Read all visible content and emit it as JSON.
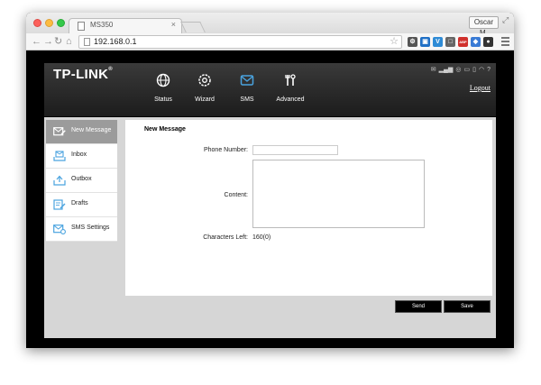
{
  "browser": {
    "tab_title": "MS350",
    "tab_close": "×",
    "user_button": "Oscar M.",
    "url": "192.168.0.1",
    "extensions": [
      {
        "name": "gear-extension-icon",
        "color": "#555555",
        "glyph": "⚙"
      },
      {
        "name": "cast-icon",
        "color": "#1f6fc5",
        "glyph": "▣"
      },
      {
        "name": "vpn-shield-icon",
        "color": "#2e8bd6",
        "glyph": "V"
      },
      {
        "name": "screen-icon",
        "color": "#666666",
        "glyph": "□"
      },
      {
        "name": "adblock-icon",
        "color": "#d0302c",
        "glyph": "ABP"
      },
      {
        "name": "puzzle-icon",
        "color": "#3a7bd5",
        "glyph": "◆"
      },
      {
        "name": "dark-circle-icon",
        "color": "#333333",
        "glyph": "●"
      }
    ]
  },
  "router": {
    "logo": "TP-LINK",
    "logo_mark": "®",
    "logout": "Logout",
    "status_icons": [
      "envelope-icon",
      "signal-icon",
      "globe-icon",
      "battery-icon",
      "sim-icon",
      "wifi-icon",
      "help-icon"
    ],
    "status_glyphs": [
      "✉",
      "▂▄▆",
      "◎",
      "▭",
      "▯",
      "◠",
      "?"
    ],
    "nav": [
      {
        "key": "status",
        "label": "Status",
        "active": false
      },
      {
        "key": "wizard",
        "label": "Wizard",
        "active": false
      },
      {
        "key": "sms",
        "label": "SMS",
        "active": true
      },
      {
        "key": "advanced",
        "label": "Advanced",
        "active": false
      }
    ],
    "sidebar": [
      {
        "key": "new-message",
        "label": "New Message",
        "active": true
      },
      {
        "key": "inbox",
        "label": "Inbox",
        "active": false
      },
      {
        "key": "outbox",
        "label": "Outbox",
        "active": false
      },
      {
        "key": "drafts",
        "label": "Drafts",
        "active": false
      },
      {
        "key": "sms-settings",
        "label": "SMS Settings",
        "active": false
      }
    ],
    "form": {
      "title": "New Message",
      "phone_label": "Phone Number:",
      "phone_value": "",
      "content_label": "Content:",
      "content_value": "",
      "chars_label": "Characters Left:",
      "chars_value": "160(0)"
    },
    "buttons": {
      "send": "Send",
      "save": "Save"
    },
    "colors": {
      "accent_blue": "#4aa3df",
      "header_dark": "#262626",
      "active_sidebar": "#9b9b9b"
    }
  }
}
